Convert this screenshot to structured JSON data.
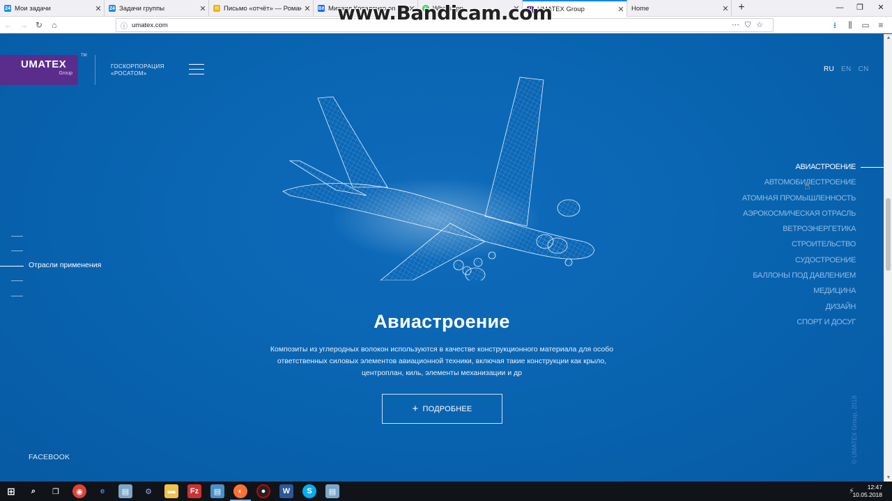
{
  "browser": {
    "tabs": [
      {
        "label": "Мои задачи",
        "icon": "bitrix24-icon",
        "color": "#1f8ce6"
      },
      {
        "label": "Задачи группы",
        "icon": "bitrix24-icon",
        "color": "#1f8ce6"
      },
      {
        "label": "Письмо «отчёт» — Романов",
        "icon": "mail-icon",
        "color": "#f0b400"
      },
      {
        "label": "Михаил Коваленко on Behance",
        "icon": "behance-icon",
        "color": "#1769ff"
      },
      {
        "label": "WhatsApp",
        "icon": "whatsapp-icon",
        "color": "#25d366"
      },
      {
        "label": "UMATEX Group",
        "icon": "umatex-icon",
        "color": "#5a2d8c"
      },
      {
        "label": "Home",
        "icon": "",
        "color": ""
      }
    ],
    "new_tab": "+",
    "url": "umatex.com",
    "watermark": "www.Bandicam.com"
  },
  "site": {
    "logo": {
      "name": "UMATEX",
      "sub": "Group",
      "tm": "TM"
    },
    "partner_line1": "ГОСКОРПОРАЦИЯ",
    "partner_line2": "«РОСАТОМ»",
    "languages": [
      {
        "label": "RU",
        "active": true
      },
      {
        "label": "EN",
        "active": false
      },
      {
        "label": "CN",
        "active": false
      }
    ],
    "left_nav_label": "Отрасли применения",
    "industries": [
      {
        "label": "Авиастроение",
        "active": true
      },
      {
        "label": "Автомобилестроение",
        "active": false
      },
      {
        "label": "Атомная промышленность",
        "active": false
      },
      {
        "label": "Аэрокосмическая отрасль",
        "active": false
      },
      {
        "label": "Ветроэнергетика",
        "active": false
      },
      {
        "label": "Строительство",
        "active": false
      },
      {
        "label": "Судостроение",
        "active": false
      },
      {
        "label": "Баллоны под давлением",
        "active": false
      },
      {
        "label": "Медицина",
        "active": false
      },
      {
        "label": "Дизайн",
        "active": false
      },
      {
        "label": "Спорт и досуг",
        "active": false
      }
    ],
    "heading": "Авиастроение",
    "description": "Композиты из углеродных волокон используются в качестве конструкционного материала для особо ответственных силовых элементов авиационной техники, включая такие конструкции как крыло, центроплан, киль, элементы механизации и др",
    "more_button": "ПОДРОБНЕЕ",
    "facebook": "FACEBOOK",
    "copyright": "© UMATEX Group, 2018",
    "colors": {
      "background": "#0a63b1",
      "logo": "#5a2d8c"
    }
  },
  "taskbar": {
    "time": "12:47",
    "date": "10.05.2018"
  }
}
